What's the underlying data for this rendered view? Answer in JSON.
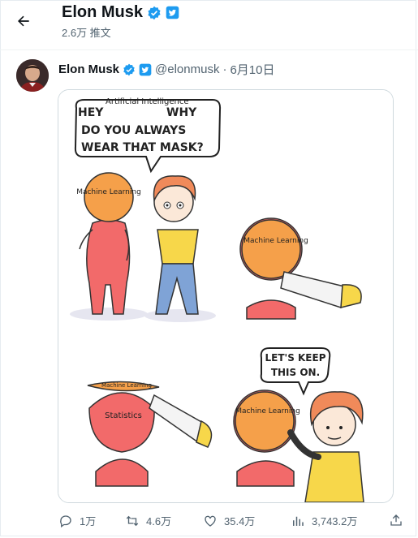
{
  "header": {
    "title": "Elon Musk",
    "subtitle": "2.6万 推文",
    "back_icon": "arrow-left-icon"
  },
  "tweet": {
    "name": "Elon Musk",
    "handle": "@elonmusk",
    "separator": "·",
    "date": "6月10日",
    "verified_color": "#1d9bf0",
    "comic": {
      "speech_top_small": "Artificial Intelligence",
      "speech_top_hey": "HEY",
      "speech_top_why": "WHY",
      "speech_top_line2": "DO YOU ALWAYS",
      "speech_top_line3": "WEAR THAT MASK?",
      "mask_label": "Machine Learning",
      "statistics_label": "Statistics",
      "speech_bottom_line1": "LET'S KEEP",
      "speech_bottom_line2": "THIS ON."
    }
  },
  "actions": {
    "reply": "1万",
    "retweet": "4.6万",
    "like": "35.4万",
    "views": "3,743.2万"
  },
  "colors": {
    "accent": "#1d9bf0",
    "secondary_text": "#536471",
    "robot_red": "#f26a6a",
    "mask_orange": "#f5a04a",
    "shirt_yellow": "#f7d74a"
  }
}
